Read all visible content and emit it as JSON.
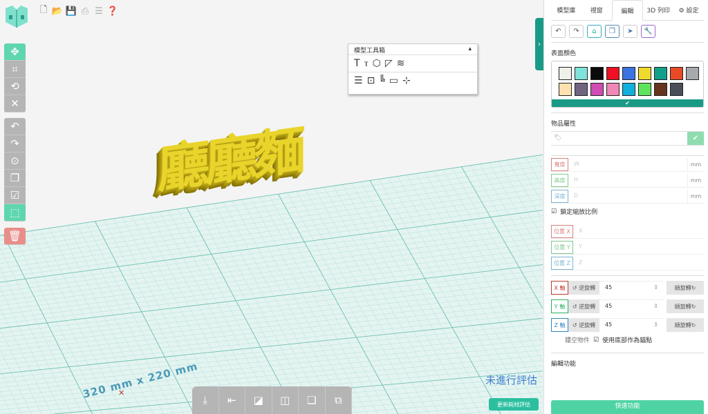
{
  "toolbar": {
    "icons": [
      "new-file-icon",
      "open-folder-icon",
      "save-icon",
      "print-icon",
      "sliders-icon",
      "help-icon"
    ]
  },
  "model_text": "廳廳麵",
  "dimension_label": "320 mm x 220 mm",
  "toolbox": {
    "title": "模型工具箱",
    "collapse": "▴",
    "row1": [
      "T",
      "ⲧ",
      "⬡",
      "◸",
      "≋"
    ],
    "row2": [
      "☰",
      "⊡",
      "╚",
      "▭",
      "⊹"
    ]
  },
  "evaluation": {
    "status": "未進行評估",
    "button": "更新耗材評估"
  },
  "panel": {
    "tabs": [
      "模型庫",
      "視窗",
      "編輯",
      "3D 列印",
      "⚙ 設定"
    ],
    "surface_color_title": "表面顏色",
    "colors": [
      "#eff0ea",
      "#7fe3dc",
      "#0b0b0b",
      "#ef1024",
      "#3b74e0",
      "#efd92d",
      "#12a08a",
      "#e84a25",
      "#a6aaac",
      "#fde2b0",
      "#706580",
      "#d04bb4",
      "#ef88b8",
      "#12b0dd",
      "#5ee45c",
      "#66331f",
      "#4a4f57"
    ],
    "color_confirm": "✔",
    "properties_title": "物品屬性",
    "tag_placeholder": "",
    "size_fields": [
      {
        "label": "寬度",
        "value": "W",
        "unit": "mm",
        "color": "#d98080"
      },
      {
        "label": "高度",
        "value": "H",
        "unit": "mm",
        "color": "#7fc98f"
      },
      {
        "label": "深度",
        "value": "D",
        "unit": "mm",
        "color": "#7ab3d4"
      }
    ],
    "lock_ratio": "鎖定縮放比例",
    "position_fields": [
      {
        "label": "位置 X",
        "value": "X",
        "color": "#d98080"
      },
      {
        "label": "位置 Y",
        "value": "Y",
        "color": "#7fc98f"
      },
      {
        "label": "位置 Z",
        "value": "Z",
        "color": "#7ab3d4"
      }
    ],
    "rotations": [
      {
        "axis": "X 軸",
        "ccw": "↺ 逆旋轉",
        "value": "45",
        "cw": "順旋轉↻",
        "color": "#c0392b"
      },
      {
        "axis": "Y 軸",
        "ccw": "↺ 逆旋轉",
        "value": "45",
        "cw": "順旋轉↻",
        "color": "#27ae60"
      },
      {
        "axis": "Z 軸",
        "ccw": "↺ 逆旋轉",
        "value": "45",
        "cw": "順旋轉↻",
        "color": "#2e86c1"
      }
    ],
    "hollow": "鏤空物件",
    "bottom_anchor": "使用底部作為錨點",
    "edit_title": "編輯功能",
    "quick_button": "快速功能"
  }
}
